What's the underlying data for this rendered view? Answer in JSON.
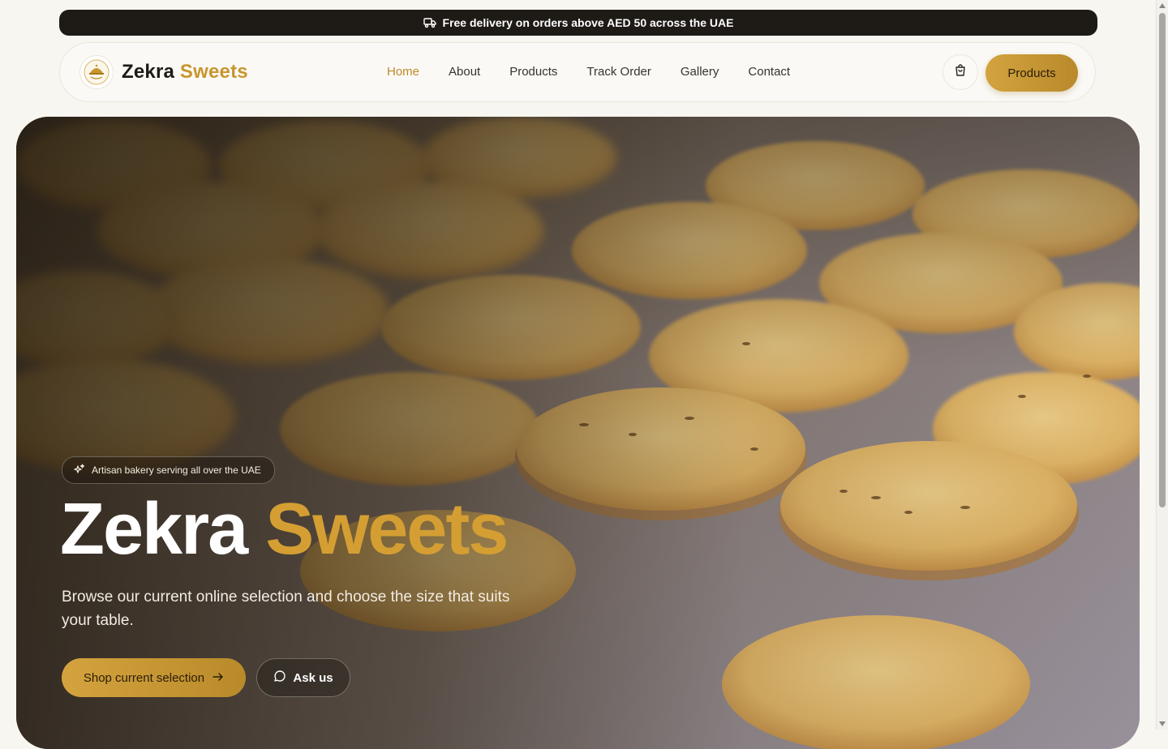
{
  "announcement": {
    "text": "Free delivery on orders above AED 50 across the UAE",
    "icon": "truck-icon"
  },
  "nav": {
    "brand": {
      "name_part1": "Zekra",
      "name_part2": "Sweets",
      "logo_icon": "bakery-logo-icon"
    },
    "menu": [
      {
        "label": "Home",
        "active": true
      },
      {
        "label": "About",
        "active": false
      },
      {
        "label": "Products",
        "active": false
      },
      {
        "label": "Track Order",
        "active": false
      },
      {
        "label": "Gallery",
        "active": false
      },
      {
        "label": "Contact",
        "active": false
      }
    ],
    "cart_icon": "shopping-bag-icon",
    "cta_label": "Products"
  },
  "hero": {
    "badge": {
      "icon": "sparkles-icon",
      "text": "Artisan bakery serving all over the UAE"
    },
    "title_part1": "Zekra",
    "title_part2": "Sweets",
    "subtitle": "Browse our current online selection and choose the size that suits your table.",
    "primary_button": {
      "label": "Shop current selection",
      "icon": "arrow-right-icon"
    },
    "secondary_button": {
      "label": "Ask us",
      "icon": "chat-bubble-icon"
    },
    "background_image": "cookies-on-baking-tray"
  },
  "colors": {
    "accent": "#c8962e",
    "dark": "#1e1a16",
    "background": "#f8f6f1"
  }
}
